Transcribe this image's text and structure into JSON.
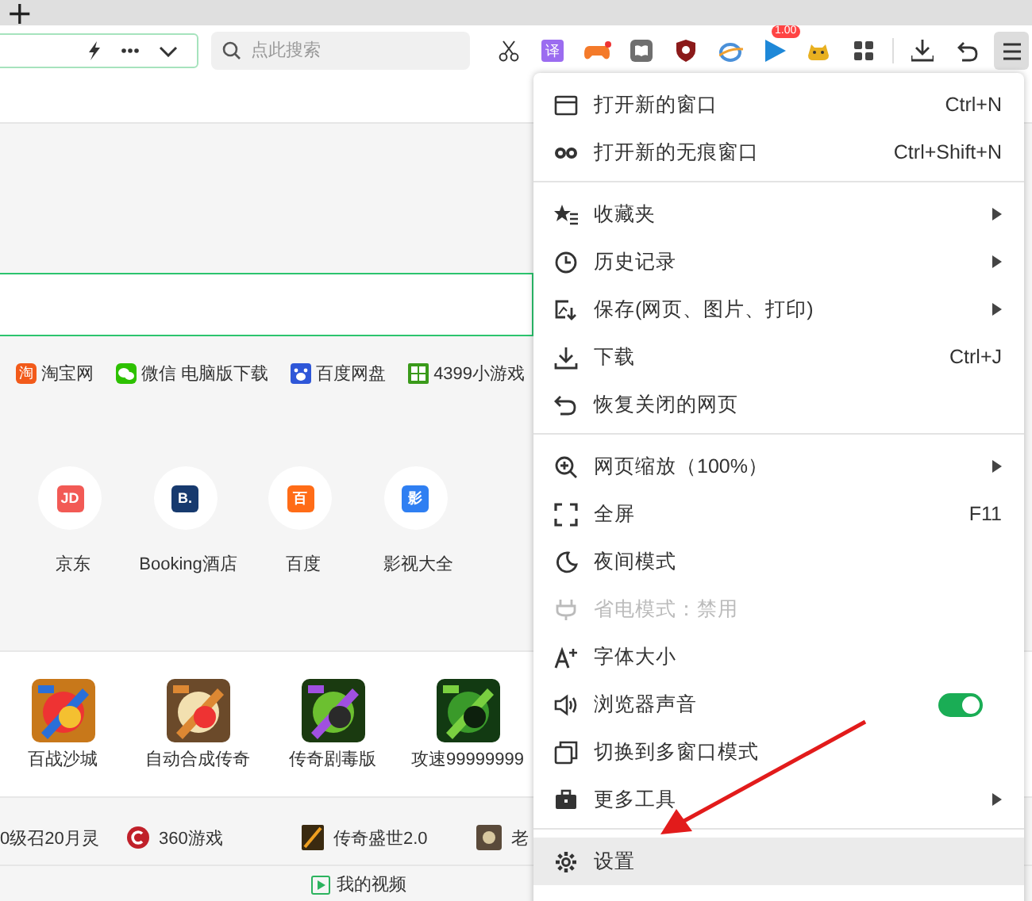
{
  "tab_bar": {
    "new_tab_button": "+"
  },
  "toolbar": {
    "address_bar": {
      "focused": true
    },
    "search": {
      "placeholder": "点此搜索"
    },
    "translate_icon_text": "译",
    "player_badge": "1.00",
    "menu_button": {
      "pressed": true
    }
  },
  "content": {
    "links": [
      {
        "label": "淘宝网",
        "icon_text": "淘"
      },
      {
        "label": "微信 电脑版下载"
      },
      {
        "label": "百度网盘"
      },
      {
        "label": "4399小游戏"
      }
    ],
    "shortcuts": [
      {
        "label": "京东",
        "icon_text": "JD",
        "color": "#f25a55"
      },
      {
        "label": "Booking酒店",
        "icon_text": "B.",
        "color": "#173a6e"
      },
      {
        "label": "百度",
        "icon_text": "百",
        "color": "#ff6c17"
      },
      {
        "label": "影视大全",
        "icon_text": "影",
        "color": "#2f7ff2"
      }
    ],
    "games": [
      {
        "label": "百战沙城"
      },
      {
        "label": "自动合成传奇"
      },
      {
        "label": "传奇剧毒版"
      },
      {
        "label": "攻速99999999"
      }
    ],
    "promo_links": [
      {
        "label": "0级召20月灵"
      },
      {
        "label": "360游戏"
      },
      {
        "label": "传奇盛世2.0"
      },
      {
        "label": "老"
      }
    ],
    "video_link": {
      "label": "我的视频"
    }
  },
  "menu": {
    "sections": [
      {
        "items": [
          {
            "kind": "command",
            "label": "打开新的窗口",
            "shortcut": "Ctrl+N",
            "disabled": false,
            "selected": false
          },
          {
            "kind": "command",
            "label": "打开新的无痕窗口",
            "shortcut": "Ctrl+Shift+N",
            "disabled": false,
            "selected": false
          }
        ]
      },
      {
        "items": [
          {
            "kind": "submenu",
            "label": "收藏夹",
            "disabled": false,
            "selected": false
          },
          {
            "kind": "submenu",
            "label": "历史记录",
            "disabled": false,
            "selected": false
          },
          {
            "kind": "submenu",
            "label": "保存(网页、图片、打印)",
            "disabled": false,
            "selected": false
          },
          {
            "kind": "command",
            "label": "下载",
            "shortcut": "Ctrl+J",
            "disabled": false,
            "selected": false
          },
          {
            "kind": "command",
            "label": "恢复关闭的网页",
            "disabled": false,
            "selected": false
          }
        ]
      },
      {
        "items": [
          {
            "kind": "submenu",
            "label": "网页缩放（100%）",
            "disabled": false,
            "selected": false
          },
          {
            "kind": "command",
            "label": "全屏",
            "shortcut": "F11",
            "disabled": false,
            "selected": false
          },
          {
            "kind": "command",
            "label": "夜间模式",
            "disabled": false,
            "selected": false
          },
          {
            "kind": "command",
            "label": "省电模式：禁用",
            "disabled": true,
            "selected": false
          },
          {
            "kind": "command",
            "label": "字体大小",
            "disabled": false,
            "selected": false
          },
          {
            "kind": "toggle",
            "label": "浏览器声音",
            "on": true,
            "disabled": false,
            "selected": false
          },
          {
            "kind": "command",
            "label": "切换到多窗口模式",
            "disabled": false,
            "selected": false
          },
          {
            "kind": "submenu",
            "label": "更多工具",
            "disabled": false,
            "selected": false
          }
        ]
      },
      {
        "items": [
          {
            "kind": "command",
            "label": "设置",
            "disabled": false,
            "selected": true
          }
        ]
      }
    ]
  }
}
